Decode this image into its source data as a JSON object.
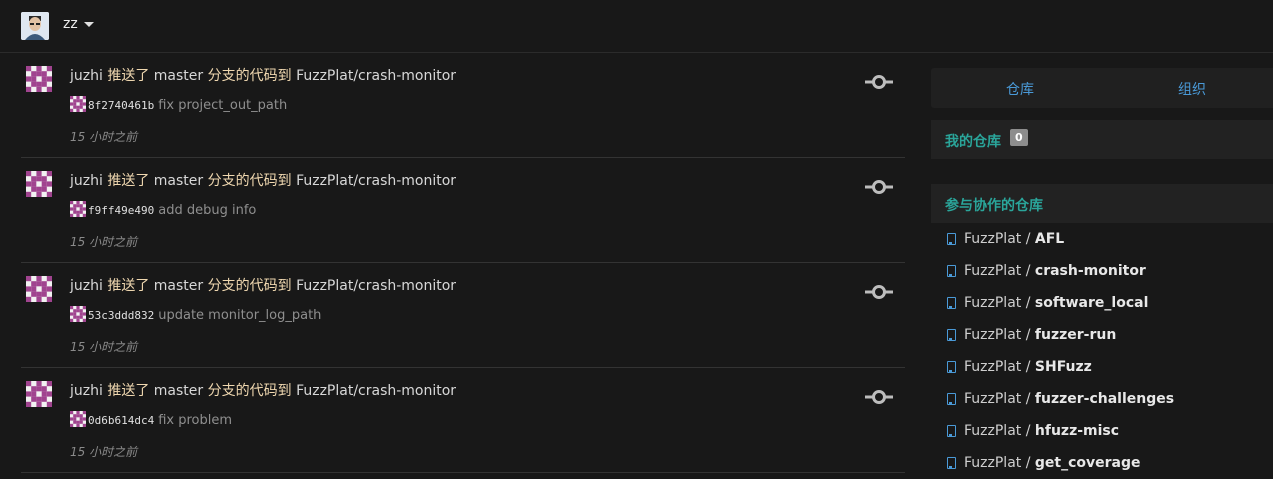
{
  "header": {
    "username": "zz"
  },
  "feed": [
    {
      "actor": "juzhi",
      "action_pushed": "推送了",
      "branch": "master",
      "action_to": "分支的代码到",
      "repo": "FuzzPlat/crash-monitor",
      "sha": "8f2740461b",
      "message": "fix project_out_path",
      "time": "15 小时之前"
    },
    {
      "actor": "juzhi",
      "action_pushed": "推送了",
      "branch": "master",
      "action_to": "分支的代码到",
      "repo": "FuzzPlat/crash-monitor",
      "sha": "f9ff49e490",
      "message": "add debug info",
      "time": "15 小时之前"
    },
    {
      "actor": "juzhi",
      "action_pushed": "推送了",
      "branch": "master",
      "action_to": "分支的代码到",
      "repo": "FuzzPlat/crash-monitor",
      "sha": "53c3ddd832",
      "message": "update monitor_log_path",
      "time": "15 小时之前"
    },
    {
      "actor": "juzhi",
      "action_pushed": "推送了",
      "branch": "master",
      "action_to": "分支的代码到",
      "repo": "FuzzPlat/crash-monitor",
      "sha": "0d6b614dc4",
      "message": "fix problem",
      "time": "15 小时之前"
    }
  ],
  "sidebar": {
    "tabs": [
      "仓库",
      "组织"
    ],
    "my_repos": {
      "title": "我的仓库",
      "count": "0"
    },
    "collab": {
      "title": "参与协作的仓库",
      "repos": [
        {
          "owner": "FuzzPlat",
          "name": "AFL"
        },
        {
          "owner": "FuzzPlat",
          "name": "crash-monitor"
        },
        {
          "owner": "FuzzPlat",
          "name": "software_local"
        },
        {
          "owner": "FuzzPlat",
          "name": "fuzzer-run"
        },
        {
          "owner": "FuzzPlat",
          "name": "SHFuzz"
        },
        {
          "owner": "FuzzPlat",
          "name": "fuzzer-challenges"
        },
        {
          "owner": "FuzzPlat",
          "name": "hfuzz-misc"
        },
        {
          "owner": "FuzzPlat",
          "name": "get_coverage"
        }
      ]
    }
  },
  "colors": {
    "accent": "#4a9ad8",
    "teal": "#2aa59a",
    "background": "#181818"
  }
}
